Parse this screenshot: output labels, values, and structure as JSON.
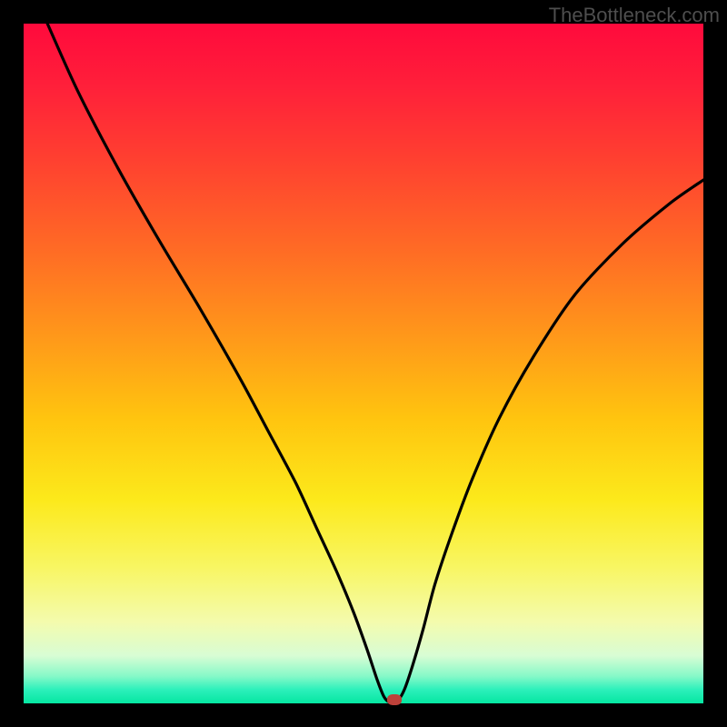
{
  "watermark": "TheBottleneck.com",
  "chart_data": {
    "type": "line",
    "title": "",
    "xlabel": "",
    "ylabel": "",
    "xlim": [
      0,
      100
    ],
    "ylim": [
      0,
      100
    ],
    "background_gradient": {
      "top_color": "#ff0a3c",
      "bottom_color": "#05e6a1",
      "description": "Vertical gradient: red (top, high value) through orange, yellow, to green (bottom, low value)"
    },
    "series": [
      {
        "name": "curve",
        "color": "#000000",
        "x": [
          3.5,
          8,
          14,
          20,
          26,
          32,
          36,
          40,
          43,
          46,
          48.5,
          50.5,
          52,
          53,
          53.8,
          55,
          56,
          57.2,
          58.8,
          60.5,
          63,
          66,
          70,
          75,
          81,
          88,
          95,
          100
        ],
        "y": [
          100,
          90,
          78.5,
          68,
          58,
          47.5,
          40,
          32.5,
          26,
          19.5,
          13.5,
          8,
          3.5,
          1,
          0.2,
          0.4,
          2,
          5.5,
          11,
          17.5,
          25,
          33,
          42,
          51,
          60,
          67.5,
          73.5,
          77
        ]
      }
    ],
    "marker": {
      "x": 54.5,
      "y": 0.6,
      "color": "#bd413a",
      "shape": "rounded-rect"
    }
  }
}
